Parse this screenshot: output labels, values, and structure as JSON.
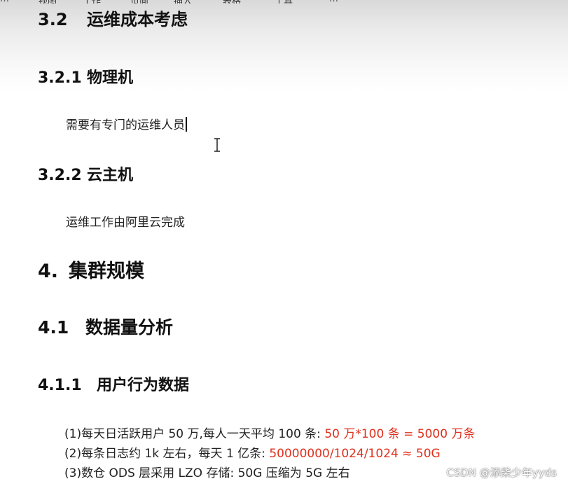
{
  "menu": [
    "…",
    "视图",
    "工作",
    "页面",
    "插入",
    "表格",
    "工具",
    "…"
  ],
  "headings": {
    "h_3_2": {
      "num": "3.2",
      "text": "运维成本考虑"
    },
    "h_3_2_1": {
      "num": "3.2.1",
      "text": "物理机"
    },
    "h_3_2_2": {
      "num": "3.2.2",
      "text": "云主机"
    },
    "h_4": {
      "num": "4.",
      "text": "集群规模"
    },
    "h_4_1": {
      "num": "4.1",
      "text": "数据量分析"
    },
    "h_4_1_1": {
      "num": "4.1.1",
      "text": "用户行为数据"
    }
  },
  "paragraphs": {
    "physical": "需要有专门的运维人员",
    "cloud": "运维工作由阿里云完成"
  },
  "list": [
    {
      "black": "(1)每天日活跃用户 50 万,每人一天平均 100 条: ",
      "red": "50 万*100 条  = 5000 万条"
    },
    {
      "black": "(2)每条日志约 1k 左右，每天 1 亿条: ",
      "red": "50000000/1024/1024  ≈  50G"
    },
    {
      "black": "(3)数仓 ODS 层采用 LZO 存储: 50G 压缩为 5G 左右",
      "red": ""
    }
  ],
  "watermark": "CSDN @添柴少年yyds",
  "colors": {
    "accent_red": "#e0301e"
  }
}
